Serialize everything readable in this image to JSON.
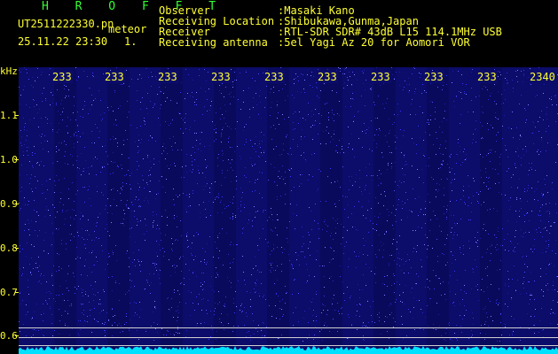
{
  "app": {
    "name": "H R O F F T",
    "file_name": "UT2511222330.pn",
    "mode_label": "meteor",
    "datetime": "25.11.22 23:30",
    "count": "1."
  },
  "station": {
    "observer_key": "Observer",
    "observer_val": ":Masaki Kano",
    "location_key": "Receiving Location",
    "location_val": ":Shibukawa,Gunma,Japan",
    "receiver_key": "Receiver",
    "receiver_val": ":RTL-SDR SDR# 43dB L15 114.1MHz USB",
    "antenna_key": "Receiving antenna",
    "antenna_val": ":5el Yagi Az 20 for Aomori VOR"
  },
  "axis": {
    "unit": "kHz",
    "y_labels": [
      "1.1",
      "1.0",
      "0.9",
      "0.8",
      "0.7",
      "0.6"
    ],
    "x_labels": [
      "233",
      "233",
      "233",
      "233",
      "233",
      "233",
      "233",
      "233",
      "233",
      "2340"
    ]
  },
  "colors": {
    "text": "#ffff33",
    "title": "#33ff33",
    "background": "#0c0c6a",
    "trace": "#00e0ff"
  }
}
